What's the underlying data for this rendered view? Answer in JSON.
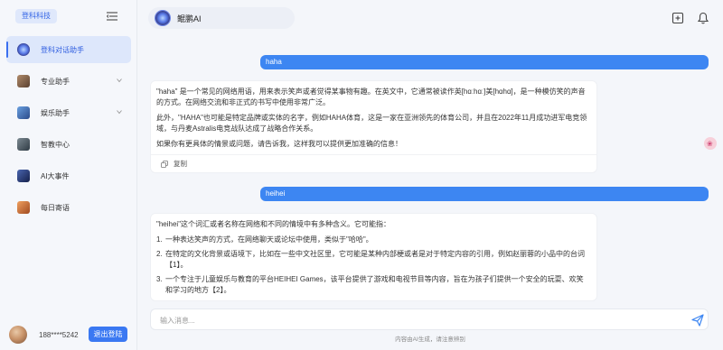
{
  "sidebar": {
    "brand": "登科科技",
    "items": [
      {
        "label": "登科对话助手",
        "icon": "assistant-icon",
        "active": true,
        "color": "#4656d8"
      },
      {
        "label": "专业助手",
        "icon": "professional-icon",
        "active": false,
        "color": "#8a6b52"
      },
      {
        "label": "娱乐助手",
        "icon": "entertainment-icon",
        "active": false,
        "color": "#3a6ab0"
      },
      {
        "label": "智教中心",
        "icon": "education-icon",
        "active": false,
        "color": "#4d5a64"
      },
      {
        "label": "AI大事件",
        "icon": "ai-events-icon",
        "active": false,
        "color": "#2c3f7a"
      },
      {
        "label": "每日寄语",
        "icon": "daily-message-icon",
        "active": false,
        "color": "#c0652e"
      }
    ],
    "user": {
      "phone": "188****5242",
      "logout_label": "退出登陆"
    }
  },
  "header": {
    "bot_name": "鲲鹏AI"
  },
  "messages": [
    {
      "role": "user",
      "text": "haha"
    },
    {
      "role": "bot",
      "paragraphs": [
        "\"haha\" 是一个常见的网络用语，用来表示笑声或者觉得某事物有趣。在英文中，它通常被读作英[hɑːhɑː]美[hɑhɑ]，是一种模仿笑的声音的方式。在网络交流和非正式的书写中使用非常广泛。",
        "此外，\"HAHA\"也可能是特定品牌或实体的名字，例如HAHA体育，这是一家在亚洲领先的体育公司，并且在2022年11月成功进军电竞领域，与丹麦Astralis电竞战队达成了战略合作关系。",
        "如果你有更具体的情景或问题，请告诉我，这样我可以提供更加准确的信息！"
      ],
      "copy_label": "复制"
    },
    {
      "role": "user",
      "text": "heihei"
    },
    {
      "role": "bot",
      "intro": "\"heihei\"这个词汇或者名称在网络和不同的情境中有多种含义。它可能指：",
      "items": [
        {
          "num": "1.",
          "text": "一种表达笑声的方式，在网络聊天或论坛中使用，类似于\"哈哈\"。"
        },
        {
          "num": "2.",
          "text": "在特定的文化背景或语境下，比如在一些中文社区里，它可能是某种内部梗或者是对于特定内容的引用，例如赵丽蓉的小品中的台词【1】。"
        },
        {
          "num": "3.",
          "text": "一个专注于儿童娱乐与教育的平台HEIHEI Games，该平台提供了游戏和电视节目等内容，旨在为孩子们提供一个安全的玩耍、欢笑和学习的地方【2】。"
        }
      ]
    }
  ],
  "composer": {
    "placeholder": "输入消息...",
    "disclaimer": "内容由AI生成，请注意辨别"
  },
  "colors": {
    "accent": "#3d86f2",
    "sidebar_active": "#dde7fb"
  }
}
